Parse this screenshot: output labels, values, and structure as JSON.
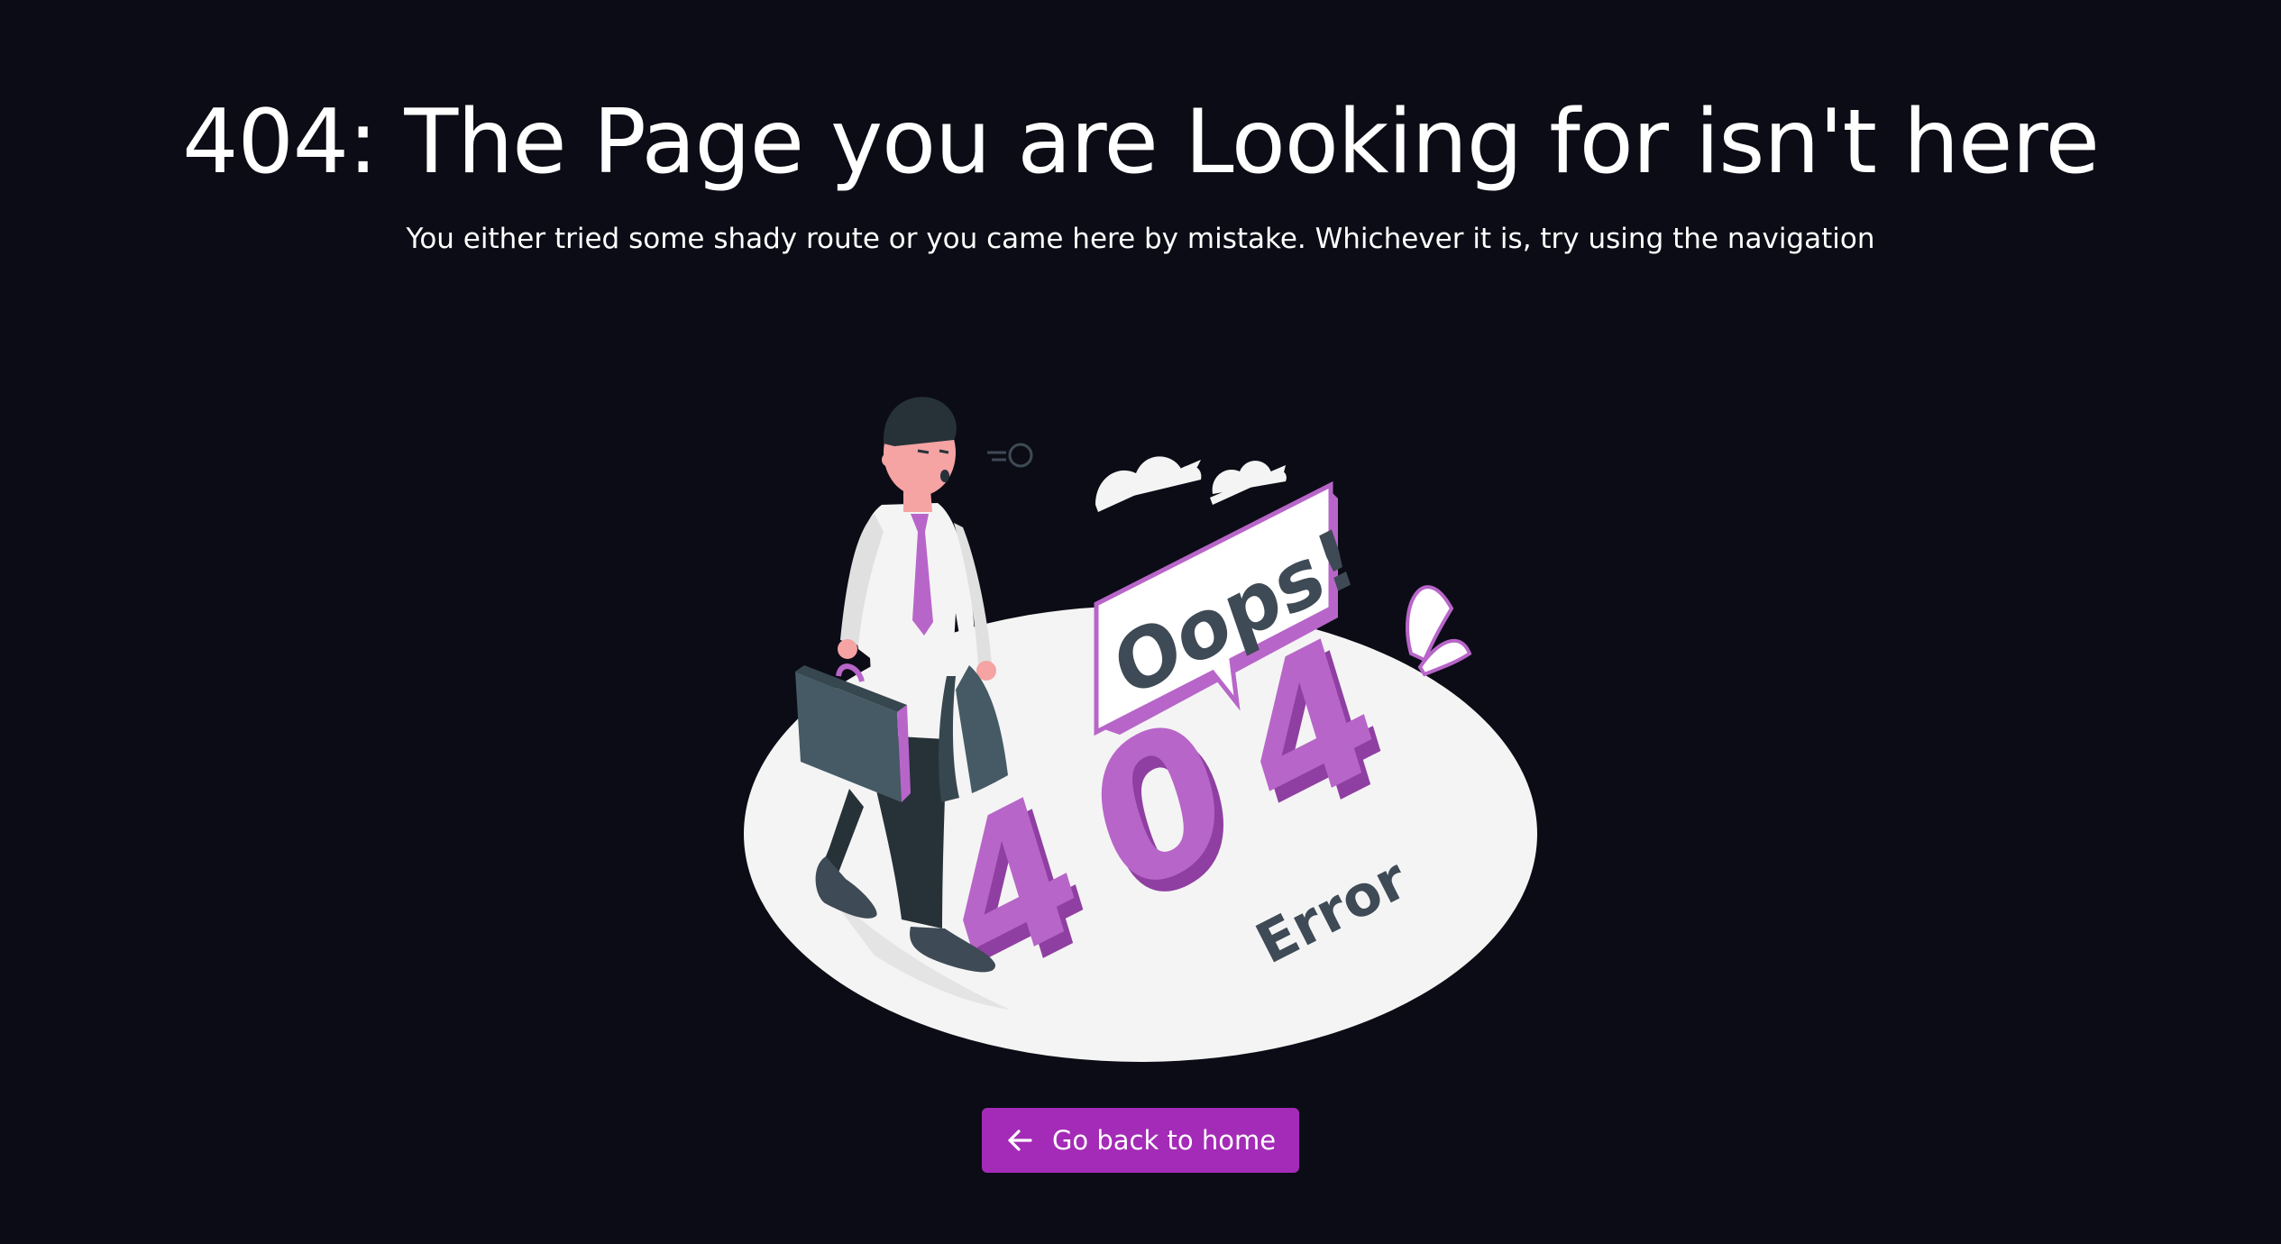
{
  "heading": {
    "title": "404: The Page you are Looking for isn't here",
    "subtitle": "You either tried some shady route or you came here by mistake. Whichever it is, try using the navigation"
  },
  "illustration": {
    "bubble_text": "Oops!",
    "big_digits": [
      "4",
      "0",
      "4"
    ],
    "error_word": "Error",
    "colors": {
      "accent_purple": "#b865c9",
      "accent_purple_dark": "#8f3fa1",
      "floor": "#f4f4f4",
      "text_dark": "#3e4a55"
    }
  },
  "button": {
    "label": "Go back to home",
    "icon": "arrow-left-icon",
    "color": "#a42bb7"
  },
  "colors": {
    "background": "#0c0c16",
    "text": "#ffffff"
  }
}
